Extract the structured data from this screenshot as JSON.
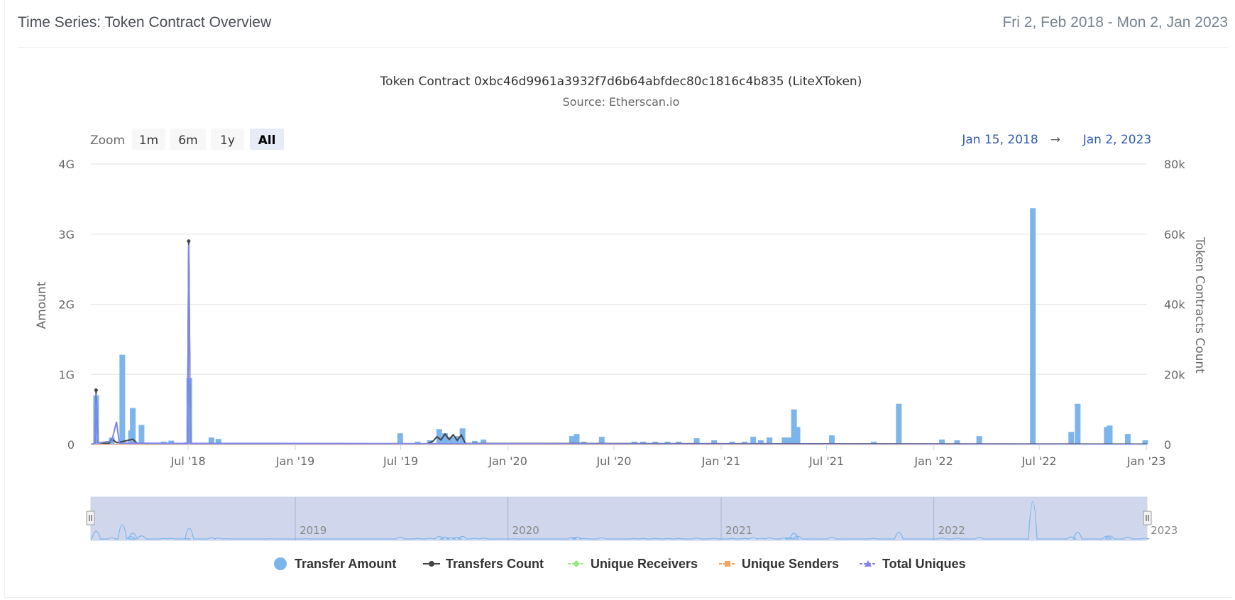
{
  "header": {
    "title": "Time Series: Token Contract Overview",
    "date_range": "Fri 2, Feb 2018 - Mon 2, Jan 2023"
  },
  "chart": {
    "title": "Token Contract 0xbc46d9961a3932f7d6b64abfdec80c1816c4b835 (LiteXToken)",
    "subtitle": "Source: Etherscan.io",
    "zoom_label": "Zoom",
    "zoom_buttons": [
      "1m",
      "6m",
      "1y",
      "All"
    ],
    "zoom_selected": "All",
    "range_from": "Jan 15, 2018",
    "range_arrow": "→",
    "range_to": "Jan 2, 2023",
    "navigator_years": [
      "2019",
      "2020",
      "2021",
      "2022",
      "2023"
    ]
  },
  "colors": {
    "transfer_amount": "#7cb5ec",
    "transfers_count": "#434348",
    "unique_receivers": "#90ed7d",
    "unique_senders": "#f7a35c",
    "total_uniques": "#8085e9",
    "range_text": "#335cad",
    "navigator_mask": "#c8d0ea"
  },
  "chart_data": {
    "type": "bar",
    "title": "Token Contract 0xbc46d9961a3932f7d6b64abfdec80c1816c4b835 (LiteXToken)",
    "subtitle": "Source: Etherscan.io",
    "xlabel": "",
    "ylabel": "Amount",
    "y2label": "Token Contracts Count",
    "x_range": [
      "2018-01-15",
      "2023-01-02"
    ],
    "ylim": [
      0,
      4000000000
    ],
    "y2lim": [
      0,
      80000
    ],
    "y_ticks": [
      "0",
      "1G",
      "2G",
      "3G",
      "4G"
    ],
    "y2_ticks": [
      "0",
      "20k",
      "40k",
      "60k",
      "80k"
    ],
    "x_ticks": [
      {
        "date": "2018-07-01",
        "label": "Jul '18"
      },
      {
        "date": "2019-01-01",
        "label": "Jan '19"
      },
      {
        "date": "2019-07-01",
        "label": "Jul '19"
      },
      {
        "date": "2020-01-01",
        "label": "Jan '20"
      },
      {
        "date": "2020-07-01",
        "label": "Jul '20"
      },
      {
        "date": "2021-01-01",
        "label": "Jan '21"
      },
      {
        "date": "2021-07-01",
        "label": "Jul '21"
      },
      {
        "date": "2022-01-01",
        "label": "Jan '22"
      },
      {
        "date": "2022-07-01",
        "label": "Jul '22"
      },
      {
        "date": "2023-01-01",
        "label": "Jan '23"
      }
    ],
    "legend_position": "bottom-center",
    "grid": true,
    "series": [
      {
        "name": "Transfer Amount",
        "type": "column",
        "axis": "left",
        "points": [
          {
            "x": "2018-01-24",
            "y": 700000000
          },
          {
            "x": "2018-02-20",
            "y": 100000000
          },
          {
            "x": "2018-03-10",
            "y": 1280000000
          },
          {
            "x": "2018-03-25",
            "y": 200000000
          },
          {
            "x": "2018-03-28",
            "y": 520000000
          },
          {
            "x": "2018-04-12",
            "y": 280000000
          },
          {
            "x": "2018-05-20",
            "y": 40000000
          },
          {
            "x": "2018-06-02",
            "y": 55000000
          },
          {
            "x": "2018-06-28",
            "y": 30000000
          },
          {
            "x": "2018-07-03",
            "y": 950000000
          },
          {
            "x": "2018-08-10",
            "y": 100000000
          },
          {
            "x": "2018-08-22",
            "y": 80000000
          },
          {
            "x": "2018-09-05",
            "y": 25000000
          },
          {
            "x": "2018-11-20",
            "y": 20000000
          },
          {
            "x": "2019-01-20",
            "y": 18000000
          },
          {
            "x": "2019-06-30",
            "y": 160000000
          },
          {
            "x": "2019-07-30",
            "y": 40000000
          },
          {
            "x": "2019-08-20",
            "y": 60000000
          },
          {
            "x": "2019-09-05",
            "y": 220000000
          },
          {
            "x": "2019-09-15",
            "y": 160000000
          },
          {
            "x": "2019-09-25",
            "y": 110000000
          },
          {
            "x": "2019-10-05",
            "y": 120000000
          },
          {
            "x": "2019-10-15",
            "y": 230000000
          },
          {
            "x": "2019-11-05",
            "y": 50000000
          },
          {
            "x": "2019-11-20",
            "y": 70000000
          },
          {
            "x": "2020-01-10",
            "y": 20000000
          },
          {
            "x": "2020-04-20",
            "y": 120000000
          },
          {
            "x": "2020-04-28",
            "y": 150000000
          },
          {
            "x": "2020-05-10",
            "y": 40000000
          },
          {
            "x": "2020-06-10",
            "y": 110000000
          },
          {
            "x": "2020-08-05",
            "y": 40000000
          },
          {
            "x": "2020-08-20",
            "y": 40000000
          },
          {
            "x": "2020-09-10",
            "y": 40000000
          },
          {
            "x": "2020-10-01",
            "y": 40000000
          },
          {
            "x": "2020-10-20",
            "y": 40000000
          },
          {
            "x": "2020-11-20",
            "y": 90000000
          },
          {
            "x": "2020-12-20",
            "y": 60000000
          },
          {
            "x": "2021-01-20",
            "y": 40000000
          },
          {
            "x": "2021-02-10",
            "y": 40000000
          },
          {
            "x": "2021-02-25",
            "y": 110000000
          },
          {
            "x": "2021-03-10",
            "y": 60000000
          },
          {
            "x": "2021-03-25",
            "y": 100000000
          },
          {
            "x": "2021-04-20",
            "y": 100000000
          },
          {
            "x": "2021-04-28",
            "y": 100000000
          },
          {
            "x": "2021-05-06",
            "y": 500000000
          },
          {
            "x": "2021-05-12",
            "y": 250000000
          },
          {
            "x": "2021-07-10",
            "y": 130000000
          },
          {
            "x": "2021-09-20",
            "y": 40000000
          },
          {
            "x": "2021-11-02",
            "y": 580000000
          },
          {
            "x": "2022-01-15",
            "y": 70000000
          },
          {
            "x": "2022-02-10",
            "y": 60000000
          },
          {
            "x": "2022-03-20",
            "y": 120000000
          },
          {
            "x": "2022-06-20",
            "y": 3370000000
          },
          {
            "x": "2022-08-25",
            "y": 180000000
          },
          {
            "x": "2022-09-05",
            "y": 580000000
          },
          {
            "x": "2022-10-25",
            "y": 250000000
          },
          {
            "x": "2022-10-30",
            "y": 270000000
          },
          {
            "x": "2022-11-30",
            "y": 150000000
          },
          {
            "x": "2022-12-30",
            "y": 60000000
          }
        ]
      },
      {
        "name": "Transfers Count",
        "type": "line",
        "axis": "right",
        "points": [
          {
            "x": "2018-01-15",
            "y": 0
          },
          {
            "x": "2018-01-22",
            "y": 300
          },
          {
            "x": "2018-01-24",
            "y": 15500
          },
          {
            "x": "2018-01-27",
            "y": 500
          },
          {
            "x": "2018-02-15",
            "y": 300
          },
          {
            "x": "2018-02-20",
            "y": 1500
          },
          {
            "x": "2018-03-01",
            "y": 500
          },
          {
            "x": "2018-03-28",
            "y": 1500
          },
          {
            "x": "2018-04-05",
            "y": 300
          },
          {
            "x": "2018-06-30",
            "y": 300
          },
          {
            "x": "2018-07-02",
            "y": 58000
          },
          {
            "x": "2018-07-05",
            "y": 300
          },
          {
            "x": "2019-08-15",
            "y": 200
          },
          {
            "x": "2019-08-25",
            "y": 900
          },
          {
            "x": "2019-09-01",
            "y": 2200
          },
          {
            "x": "2019-09-08",
            "y": 1300
          },
          {
            "x": "2019-09-15",
            "y": 3000
          },
          {
            "x": "2019-09-22",
            "y": 1400
          },
          {
            "x": "2019-09-29",
            "y": 2800
          },
          {
            "x": "2019-10-06",
            "y": 1200
          },
          {
            "x": "2019-10-13",
            "y": 2700
          },
          {
            "x": "2019-10-20",
            "y": 300
          },
          {
            "x": "2023-01-02",
            "y": 100
          }
        ]
      },
      {
        "name": "Unique Receivers",
        "type": "line",
        "axis": "right",
        "points": [
          {
            "x": "2018-01-15",
            "y": 0
          },
          {
            "x": "2023-01-02",
            "y": 0
          }
        ]
      },
      {
        "name": "Unique Senders",
        "type": "line",
        "axis": "right",
        "points": [
          {
            "x": "2018-01-15",
            "y": 0
          },
          {
            "x": "2023-01-02",
            "y": 0
          }
        ]
      },
      {
        "name": "Total Uniques",
        "type": "line",
        "axis": "right",
        "points": [
          {
            "x": "2018-01-15",
            "y": 0
          },
          {
            "x": "2018-01-22",
            "y": 300
          },
          {
            "x": "2018-01-24",
            "y": 14500
          },
          {
            "x": "2018-01-27",
            "y": 400
          },
          {
            "x": "2018-02-20",
            "y": 1000
          },
          {
            "x": "2018-02-28",
            "y": 6500
          },
          {
            "x": "2018-03-05",
            "y": 400
          },
          {
            "x": "2018-06-30",
            "y": 300
          },
          {
            "x": "2018-07-02",
            "y": 57000
          },
          {
            "x": "2018-07-05",
            "y": 300
          },
          {
            "x": "2023-01-02",
            "y": 0
          }
        ]
      }
    ]
  }
}
